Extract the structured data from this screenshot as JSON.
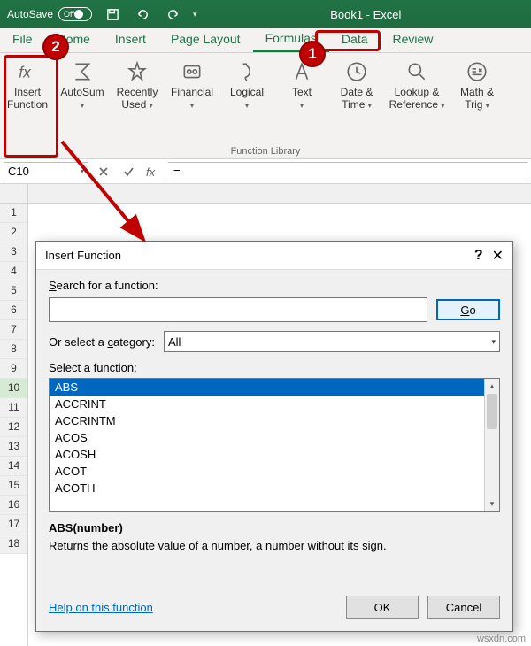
{
  "title_bar": {
    "autosave_label": "AutoSave",
    "autosave_state": "Off",
    "doc_title": "Book1 - Excel"
  },
  "tabs": {
    "file": "File",
    "home": "Home",
    "insert": "Insert",
    "page_layout": "Page Layout",
    "formulas": "Formulas",
    "data": "Data",
    "review": "Review"
  },
  "ribbon": {
    "insert_function": "Insert\nFunction",
    "autosum": "AutoSum",
    "recently_used": "Recently\nUsed",
    "financial": "Financial",
    "logical": "Logical",
    "text": "Text",
    "date_time": "Date &\nTime",
    "lookup_ref": "Lookup &\nReference",
    "math_trig": "Math &\nTrig",
    "group_label": "Function Library"
  },
  "namebar": {
    "cell_ref": "C10",
    "formula": "="
  },
  "rows": [
    "1",
    "2",
    "3",
    "4",
    "5",
    "6",
    "7",
    "8",
    "9",
    "10",
    "11",
    "12",
    "13",
    "14",
    "15",
    "16",
    "17",
    "18"
  ],
  "dialog": {
    "title": "Insert Function",
    "search_label": "Search for a function:",
    "search_value": "",
    "go": "Go",
    "category_label": "Or select a category:",
    "category_value": "All",
    "select_label": "Select a function:",
    "items": [
      "ABS",
      "ACCRINT",
      "ACCRINTM",
      "ACOS",
      "ACOSH",
      "ACOT",
      "ACOTH"
    ],
    "syntax": "ABS(number)",
    "description": "Returns the absolute value of a number, a number without its sign.",
    "help_link": "Help on this function",
    "ok": "OK",
    "cancel": "Cancel"
  },
  "watermark": "wsxdn.com"
}
